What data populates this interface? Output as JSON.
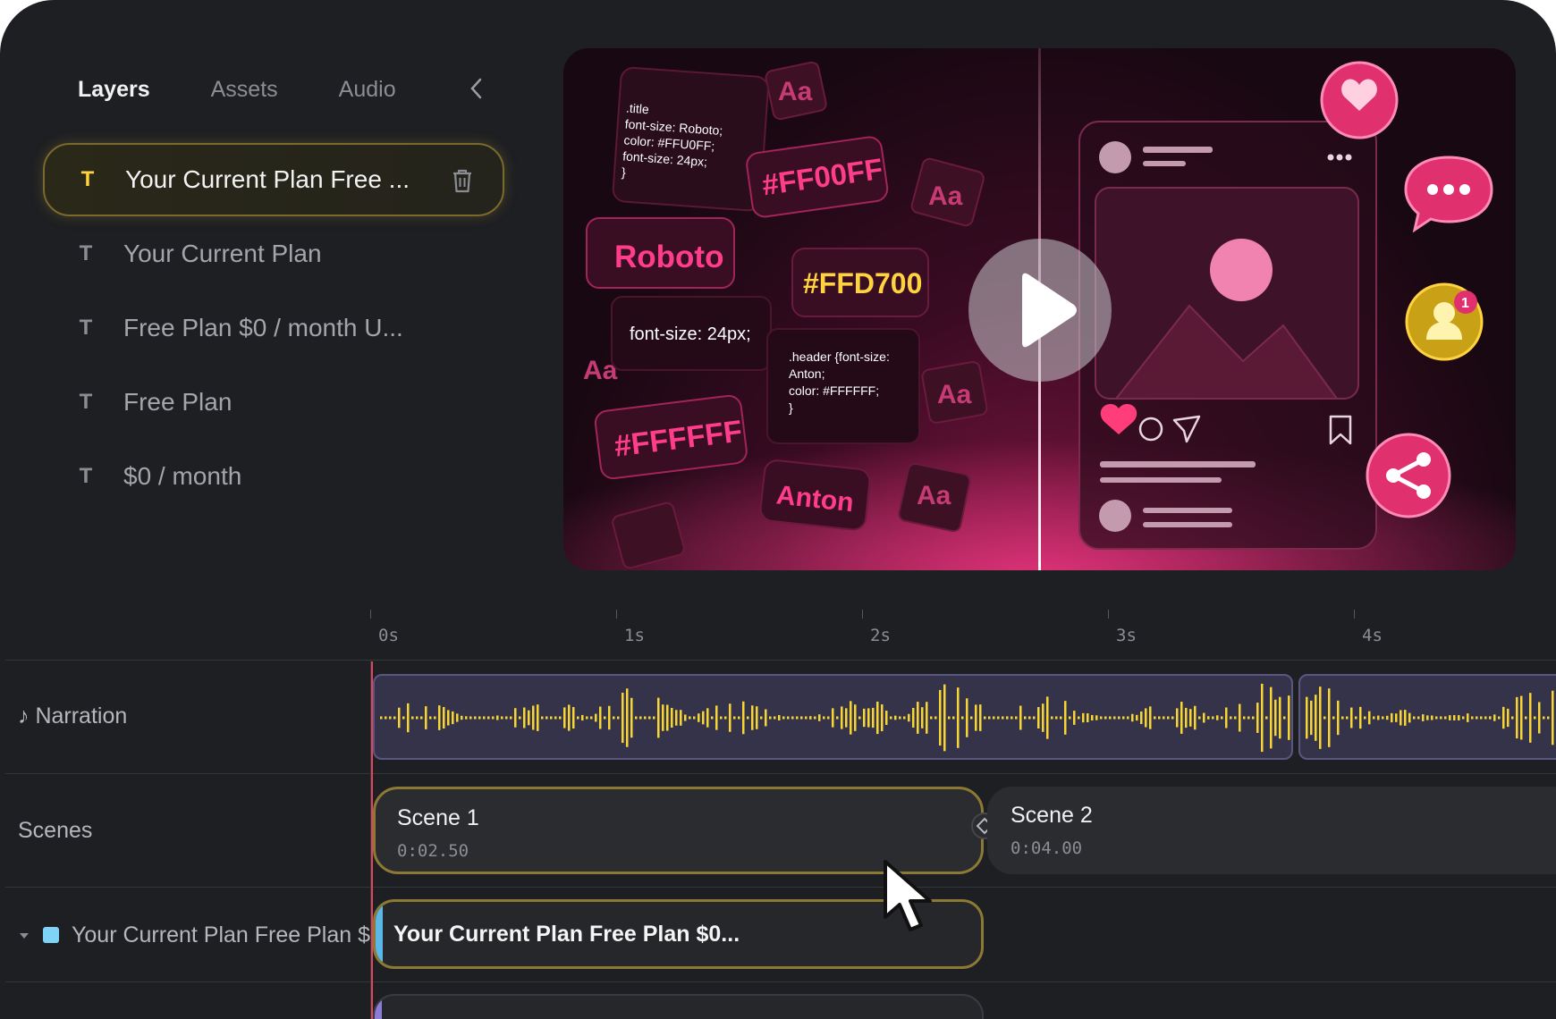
{
  "sidebar": {
    "tabs": [
      {
        "label": "Layers",
        "active": true
      },
      {
        "label": "Assets",
        "active": false
      },
      {
        "label": "Audio",
        "active": false
      }
    ],
    "collapse_icon": "chevron-left-icon",
    "layers": [
      {
        "type": "T",
        "label": "Your Current Plan Free ...",
        "selected": true
      },
      {
        "type": "T",
        "label": "Your Current Plan",
        "selected": false
      },
      {
        "type": "T",
        "label": "Free Plan $0 / month U...",
        "selected": false
      },
      {
        "type": "T",
        "label": "Free Plan",
        "selected": false
      },
      {
        "type": "T",
        "label": "$0 / month",
        "selected": false
      }
    ]
  },
  "preview": {
    "chips": {
      "code1": [
        ".title",
        "font-size: Roboto;",
        "color: #FFU0FF;",
        "font-size: 24px;",
        "}"
      ],
      "hex_magenta": "#FF00FF",
      "roboto": "Roboto",
      "hex_gold": "#FFD700",
      "size": "font-size: 24px;",
      "code2": [
        ".header {font-size:",
        "Anton;",
        "color: #FFFFFF;",
        "}"
      ],
      "hex_white": "#FFFFFF",
      "anton": "Anton",
      "aa": "Aa"
    },
    "badge_count": "1",
    "accent_color": "#ff3d8b"
  },
  "timeline": {
    "ruler": [
      "0s",
      "1s",
      "2s",
      "3s",
      "4s"
    ],
    "tracks": {
      "narration": "♪ Narration",
      "scenes": "Scenes",
      "text_layer": "Your Current Plan Free Plan $0..."
    },
    "scenes": [
      {
        "name": "Scene 1",
        "duration": "0:02.50"
      },
      {
        "name": "Scene 2",
        "duration": "0:04.00"
      }
    ],
    "text_clip_label": "Your Current Plan Free Plan $0...",
    "colors": {
      "waveform": "#f6d534",
      "playhead": "#e0455a",
      "selection": "#8c7a34",
      "text_track": "#7fd3f7"
    }
  }
}
